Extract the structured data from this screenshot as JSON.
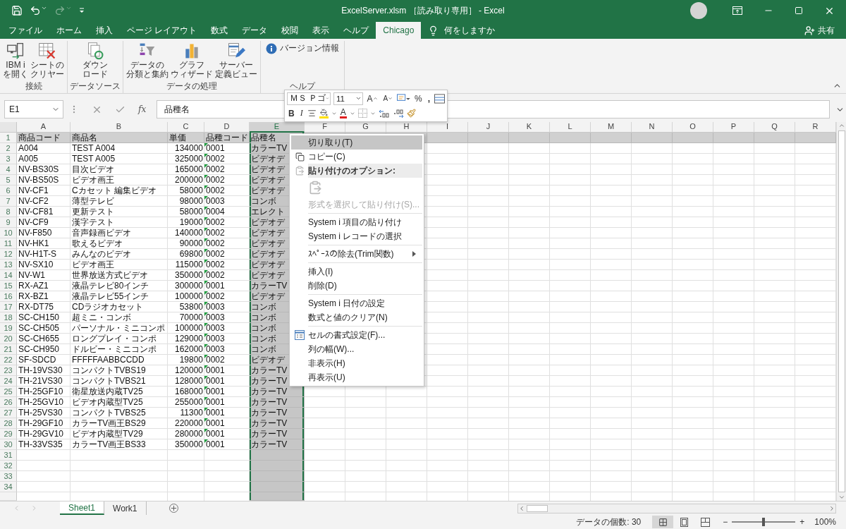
{
  "quick_access": [
    {
      "kind": "save",
      "disabled": false
    },
    {
      "kind": "undo",
      "disabled": false
    },
    {
      "kind": "redo",
      "disabled": true
    },
    {
      "kind": "customize",
      "disabled": false
    }
  ],
  "title": "ExcelServer.xlsm ［読み取り専用］ - Excel",
  "tabs": [
    {
      "label": "ファイル",
      "selected": false
    },
    {
      "label": "ホーム",
      "selected": false
    },
    {
      "label": "挿入",
      "selected": false
    },
    {
      "label": "ページ レイアウト",
      "selected": false
    },
    {
      "label": "数式",
      "selected": false
    },
    {
      "label": "データ",
      "selected": false
    },
    {
      "label": "校閲",
      "selected": false
    },
    {
      "label": "表示",
      "selected": false
    },
    {
      "label": "ヘルプ",
      "selected": false
    },
    {
      "label": "Chicago",
      "selected": true
    }
  ],
  "tell_me": "何をしますか",
  "share": "共有",
  "ribbon_groups": [
    {
      "label": "接続",
      "buttons": [
        {
          "kind": "open-ibmi",
          "lines": [
            "IBM i",
            "を開く"
          ]
        },
        {
          "kind": "clear-sheet",
          "lines": [
            "シートの",
            "クリヤー"
          ]
        }
      ]
    },
    {
      "label": "データソース",
      "buttons": [
        {
          "kind": "download",
          "lines": [
            "ダウン",
            "ロード"
          ]
        }
      ]
    },
    {
      "label": "データの処理",
      "buttons": [
        {
          "kind": "sort-summary",
          "lines": [
            "データの",
            "分類と集約"
          ]
        },
        {
          "kind": "chart-wizard",
          "lines": [
            "グラフ",
            "ウィザード"
          ]
        },
        {
          "kind": "server-view",
          "lines": [
            "サーバー",
            "定義ビュー"
          ]
        }
      ]
    },
    {
      "label": "ヘルプ",
      "buttons": [
        {
          "kind": "version",
          "lines": [
            "バージョン情報"
          ]
        }
      ]
    }
  ],
  "formula_bar": {
    "name_box": "E1",
    "fx": "fx",
    "value": "品種名"
  },
  "mini_toolbar": {
    "font": "ＭＳ Ｐゴ",
    "size": "11",
    "grow": "A",
    "shrink": "A",
    "percent": "%",
    "comma": ",",
    "bold": "B",
    "italic": "I",
    "font_color": "A"
  },
  "columns": [
    {
      "letter": "A",
      "selected": false
    },
    {
      "letter": "B",
      "selected": false
    },
    {
      "letter": "C",
      "selected": false
    },
    {
      "letter": "D",
      "selected": false
    },
    {
      "letter": "E",
      "selected": true
    },
    {
      "letter": "F",
      "selected": false
    },
    {
      "letter": "G",
      "selected": false
    },
    {
      "letter": "H",
      "selected": false
    },
    {
      "letter": "I",
      "selected": false
    },
    {
      "letter": "J",
      "selected": false
    },
    {
      "letter": "K",
      "selected": false
    },
    {
      "letter": "L",
      "selected": false
    },
    {
      "letter": "M",
      "selected": false
    },
    {
      "letter": "N",
      "selected": false
    },
    {
      "letter": "O",
      "selected": false
    },
    {
      "letter": "P",
      "selected": false
    },
    {
      "letter": "Q",
      "selected": false
    },
    {
      "letter": "R",
      "selected": false
    }
  ],
  "rows": [
    {
      "number": "1",
      "kind": "header",
      "cells": [
        "商品コード",
        "商品名",
        "単価",
        "品種コード",
        "品種名"
      ]
    },
    {
      "number": "2",
      "kind": "record",
      "warning": true,
      "cells": [
        "A004",
        "TEST A004",
        "134000",
        "0001",
        "カラーTV"
      ]
    },
    {
      "number": "3",
      "kind": "record",
      "warning": true,
      "cells": [
        "A005",
        "TEST A005",
        "325000",
        "0002",
        "ビデオデ"
      ]
    },
    {
      "number": "4",
      "kind": "record",
      "warning": true,
      "cells": [
        "NV-BS30S",
        "目次ビデオ",
        "165000",
        "0002",
        "ビデオデ"
      ]
    },
    {
      "number": "5",
      "kind": "record",
      "warning": true,
      "cells": [
        "NV-BS50S",
        "ビデオ画王",
        "200000",
        "0002",
        "ビデオデ"
      ]
    },
    {
      "number": "6",
      "kind": "record",
      "warning": true,
      "cells": [
        "NV-CF1",
        "Cカセット 編集ビデオ",
        "58000",
        "0002",
        "ビデオデ"
      ]
    },
    {
      "number": "7",
      "kind": "record",
      "warning": true,
      "cells": [
        "NV-CF2",
        "薄型テレビ",
        "98000",
        "0003",
        "コンボ"
      ]
    },
    {
      "number": "8",
      "kind": "record",
      "warning": true,
      "cells": [
        "NV-CF81",
        "更新テスト",
        "58000",
        "0004",
        "エレクト"
      ]
    },
    {
      "number": "9",
      "kind": "record",
      "warning": true,
      "cells": [
        "NV-CF9",
        "漢字テスト",
        "19000",
        "0002",
        "ビデオデ"
      ]
    },
    {
      "number": "10",
      "kind": "record",
      "warning": true,
      "cells": [
        "NV-F850",
        "音声録画ビデオ",
        "140000",
        "0002",
        "ビデオデ"
      ]
    },
    {
      "number": "11",
      "kind": "record",
      "warning": true,
      "cells": [
        "NV-HK1",
        "歌えるビデオ",
        "90000",
        "0002",
        "ビデオデ"
      ]
    },
    {
      "number": "12",
      "kind": "record",
      "warning": true,
      "cells": [
        "NV-H1T-S",
        "みんなのビデオ",
        "69800",
        "0002",
        "ビデオデ"
      ]
    },
    {
      "number": "13",
      "kind": "record",
      "warning": true,
      "cells": [
        "NV-SX10",
        "ビデオ画王",
        "115000",
        "0002",
        "ビデオデ"
      ]
    },
    {
      "number": "14",
      "kind": "record",
      "warning": true,
      "cells": [
        "NV-W1",
        "世界放送方式ビデオ",
        "350000",
        "0002",
        "ビデオデ"
      ]
    },
    {
      "number": "15",
      "kind": "record",
      "warning": true,
      "cells": [
        "RX-AZ1",
        "液晶テレビ80インチ",
        "300000",
        "0001",
        "カラーTV"
      ]
    },
    {
      "number": "16",
      "kind": "record",
      "warning": true,
      "cells": [
        "RX-BZ1",
        "液晶テレビ55インチ",
        "100000",
        "0002",
        "ビデオデ"
      ]
    },
    {
      "number": "17",
      "kind": "record",
      "warning": true,
      "cells": [
        "RX-DT75",
        "CDラジオカセット",
        "53800",
        "0003",
        "コンボ"
      ]
    },
    {
      "number": "18",
      "kind": "record",
      "warning": true,
      "cells": [
        "SC-CH150",
        "超ミニ・コンボ",
        "70000",
        "0003",
        "コンボ"
      ]
    },
    {
      "number": "19",
      "kind": "record",
      "warning": true,
      "cells": [
        "SC-CH505",
        "パーソナル・ミニコンポ",
        "100000",
        "0003",
        "コンボ"
      ]
    },
    {
      "number": "20",
      "kind": "record",
      "warning": true,
      "cells": [
        "SC-CH655",
        "ロングプレイ・コンポ",
        "129000",
        "0003",
        "コンボ"
      ]
    },
    {
      "number": "21",
      "kind": "record",
      "warning": true,
      "cells": [
        "SC-CH950",
        "ドルビー・ミニコンポ",
        "162000",
        "0003",
        "コンボ"
      ]
    },
    {
      "number": "22",
      "kind": "record",
      "warning": true,
      "cells": [
        "SF-SDCD",
        "FFFFFAABBCCDD",
        "19800",
        "0002",
        "ビデオデ"
      ]
    },
    {
      "number": "23",
      "kind": "record",
      "warning": true,
      "cells": [
        "TH-19VS30",
        "コンパクトTVBS19",
        "120000",
        "0001",
        "カラーTV"
      ]
    },
    {
      "number": "24",
      "kind": "record",
      "warning": true,
      "cells": [
        "TH-21VS30",
        "コンパクトTVBS21",
        "128000",
        "0001",
        "カラーTV"
      ]
    },
    {
      "number": "25",
      "kind": "record",
      "warning": true,
      "cells": [
        "TH-25GF10",
        "衛星放送内蔵TV25",
        "168000",
        "0001",
        "カラーTV"
      ]
    },
    {
      "number": "26",
      "kind": "record",
      "warning": true,
      "cells": [
        "TH-25GV10",
        "ビデオ内蔵型TV25",
        "255000",
        "0001",
        "カラーTV"
      ]
    },
    {
      "number": "27",
      "kind": "record",
      "warning": true,
      "cells": [
        "TH-25VS30",
        "コンパクトTVBS25",
        "11300",
        "0001",
        "カラーTV"
      ]
    },
    {
      "number": "28",
      "kind": "record",
      "warning": true,
      "cells": [
        "TH-29GF10",
        "カラーTV画王BS29",
        "220000",
        "0001",
        "カラーTV"
      ]
    },
    {
      "number": "29",
      "kind": "record",
      "warning": true,
      "cells": [
        "TH-29GV10",
        "ビデオ内蔵型TV29",
        "280000",
        "0001",
        "カラーTV"
      ]
    },
    {
      "number": "30",
      "kind": "record",
      "warning": true,
      "cells": [
        "TH-33VS35",
        "カラーTV画王BS33",
        "350000",
        "0001",
        "カラーTV"
      ]
    },
    {
      "number": "31",
      "kind": "empty",
      "cells": []
    },
    {
      "number": "32",
      "kind": "empty",
      "cells": []
    },
    {
      "number": "33",
      "kind": "empty",
      "cells": []
    },
    {
      "number": "34",
      "kind": "empty",
      "cells": []
    }
  ],
  "context_menu": [
    {
      "kind": "item",
      "label": "切り取り(T)",
      "highlighted": true,
      "disabled": false
    },
    {
      "kind": "copy",
      "label": "コピー(C)",
      "highlighted": false,
      "disabled": false
    },
    {
      "kind": "heading",
      "label": "貼り付けのオプション:"
    },
    {
      "kind": "paste-options",
      "disabled": true
    },
    {
      "kind": "item",
      "label": "形式を選択して貼り付け(S)...",
      "highlighted": false,
      "disabled": true
    },
    {
      "kind": "separator"
    },
    {
      "kind": "item",
      "label": "System i 項目の貼り付け",
      "highlighted": false,
      "disabled": false
    },
    {
      "kind": "item",
      "label": "System i レコードの選択",
      "highlighted": false,
      "disabled": false
    },
    {
      "kind": "separator"
    },
    {
      "kind": "submenu",
      "label": "ｽﾍﾟｰｽの除去(Trim関数)",
      "highlighted": false,
      "disabled": false
    },
    {
      "kind": "separator"
    },
    {
      "kind": "item",
      "label": "挿入(I)",
      "highlighted": false,
      "disabled": false
    },
    {
      "kind": "item",
      "label": "削除(D)",
      "highlighted": false,
      "disabled": false
    },
    {
      "kind": "separator"
    },
    {
      "kind": "item",
      "label": "System i 日付の設定",
      "highlighted": false,
      "disabled": false
    },
    {
      "kind": "item",
      "label": "数式と値のクリア(N)",
      "highlighted": false,
      "disabled": false
    },
    {
      "kind": "separator"
    },
    {
      "kind": "format-cells",
      "label": "セルの書式設定(F)...",
      "highlighted": false,
      "disabled": false
    },
    {
      "kind": "item",
      "label": "列の幅(W)...",
      "highlighted": false,
      "disabled": false
    },
    {
      "kind": "item",
      "label": "非表示(H)",
      "highlighted": false,
      "disabled": false
    },
    {
      "kind": "item",
      "label": "再表示(U)",
      "highlighted": false,
      "disabled": false
    }
  ],
  "sheet_tabs": [
    {
      "label": "Sheet1",
      "selected": true
    },
    {
      "label": "Work1",
      "selected": false
    }
  ],
  "status_bar": {
    "summary": "データの個数: 30",
    "views": [
      {
        "kind": "normal",
        "selected": true
      },
      {
        "kind": "page-layout",
        "selected": false
      },
      {
        "kind": "page-break",
        "selected": false
      }
    ],
    "zoom_out": "−",
    "zoom_in": "+",
    "zoom": {
      "level": 0.5
    },
    "zoom_reading": "100%"
  }
}
